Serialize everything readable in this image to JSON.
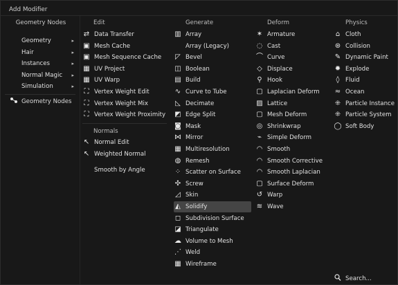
{
  "menu": {
    "title": "Add Modifier"
  },
  "left": {
    "header": "Geometry Nodes",
    "items": [
      {
        "label": "Geometry",
        "arrow": "▸"
      },
      {
        "label": "Hair",
        "arrow": "▸"
      },
      {
        "label": "Instances",
        "arrow": "▸"
      },
      {
        "label": "Normal Magic",
        "arrow": "▸"
      },
      {
        "label": "Simulation",
        "arrow": "▸"
      }
    ],
    "geometry_nodes": {
      "label": "Geometry Nodes",
      "icon": "geometry-nodes-icon"
    }
  },
  "edit": {
    "header": "Edit",
    "items": [
      {
        "label": "Data Transfer",
        "icon": "data-transfer-icon"
      },
      {
        "label": "Mesh Cache",
        "icon": "mesh-cache-icon"
      },
      {
        "label": "Mesh Sequence Cache",
        "icon": "mesh-sequence-cache-icon"
      },
      {
        "label": "UV Project",
        "icon": "uv-project-icon"
      },
      {
        "label": "UV Warp",
        "icon": "uv-warp-icon"
      },
      {
        "label": "Vertex Weight Edit",
        "icon": "vertex-weight-edit-icon"
      },
      {
        "label": "Vertex Weight Mix",
        "icon": "vertex-weight-mix-icon"
      },
      {
        "label": "Vertex Weight Proximity",
        "icon": "vertex-weight-proximity-icon"
      }
    ]
  },
  "normals": {
    "header": "Normals",
    "items": [
      {
        "label": "Normal Edit",
        "icon": "normal-edit-icon"
      },
      {
        "label": "Weighted Normal",
        "icon": "weighted-normal-icon"
      },
      {
        "label": "Smooth by Angle",
        "icon": ""
      }
    ]
  },
  "generate": {
    "header": "Generate",
    "items": [
      {
        "label": "Array",
        "icon": "array-icon"
      },
      {
        "label": "Array (Legacy)",
        "icon": ""
      },
      {
        "label": "Bevel",
        "icon": "bevel-icon"
      },
      {
        "label": "Boolean",
        "icon": "boolean-icon"
      },
      {
        "label": "Build",
        "icon": "build-icon"
      },
      {
        "label": "Curve to Tube",
        "icon": "curve-to-tube-icon"
      },
      {
        "label": "Decimate",
        "icon": "decimate-icon"
      },
      {
        "label": "Edge Split",
        "icon": "edge-split-icon"
      },
      {
        "label": "Mask",
        "icon": "mask-icon"
      },
      {
        "label": "Mirror",
        "icon": "mirror-icon"
      },
      {
        "label": "Multiresolution",
        "icon": "multiresolution-icon"
      },
      {
        "label": "Remesh",
        "icon": "remesh-icon"
      },
      {
        "label": "Scatter on Surface",
        "icon": "scatter-on-surface-icon"
      },
      {
        "label": "Screw",
        "icon": "screw-icon"
      },
      {
        "label": "Skin",
        "icon": "skin-icon"
      },
      {
        "label": "Solidify",
        "icon": "solidify-icon",
        "highlighted": true
      },
      {
        "label": "Subdivision Surface",
        "icon": "subdivision-surface-icon"
      },
      {
        "label": "Triangulate",
        "icon": "triangulate-icon"
      },
      {
        "label": "Volume to Mesh",
        "icon": "volume-to-mesh-icon"
      },
      {
        "label": "Weld",
        "icon": "weld-icon"
      },
      {
        "label": "Wireframe",
        "icon": "wireframe-icon"
      }
    ]
  },
  "deform": {
    "header": "Deform",
    "items": [
      {
        "label": "Armature",
        "icon": "armature-icon"
      },
      {
        "label": "Cast",
        "icon": "cast-icon"
      },
      {
        "label": "Curve",
        "icon": "curve-icon"
      },
      {
        "label": "Displace",
        "icon": "displace-icon"
      },
      {
        "label": "Hook",
        "icon": "hook-icon"
      },
      {
        "label": "Laplacian Deform",
        "icon": "laplacian-deform-icon"
      },
      {
        "label": "Lattice",
        "icon": "lattice-icon"
      },
      {
        "label": "Mesh Deform",
        "icon": "mesh-deform-icon"
      },
      {
        "label": "Shrinkwrap",
        "icon": "shrinkwrap-icon"
      },
      {
        "label": "Simple Deform",
        "icon": "simple-deform-icon"
      },
      {
        "label": "Smooth",
        "icon": "smooth-icon"
      },
      {
        "label": "Smooth Corrective",
        "icon": "smooth-corrective-icon"
      },
      {
        "label": "Smooth Laplacian",
        "icon": "smooth-laplacian-icon"
      },
      {
        "label": "Surface Deform",
        "icon": "surface-deform-icon"
      },
      {
        "label": "Warp",
        "icon": "warp-icon"
      },
      {
        "label": "Wave",
        "icon": "wave-icon"
      }
    ]
  },
  "physics": {
    "header": "Physics",
    "items": [
      {
        "label": "Cloth",
        "icon": "cloth-icon"
      },
      {
        "label": "Collision",
        "icon": "collision-icon"
      },
      {
        "label": "Dynamic Paint",
        "icon": "dynamic-paint-icon"
      },
      {
        "label": "Explode",
        "icon": "explode-icon"
      },
      {
        "label": "Fluid",
        "icon": "fluid-icon"
      },
      {
        "label": "Ocean",
        "icon": "ocean-icon"
      },
      {
        "label": "Particle Instance",
        "icon": "particle-instance-icon"
      },
      {
        "label": "Particle System",
        "icon": "particle-system-icon"
      },
      {
        "label": "Soft Body",
        "icon": "soft-body-icon"
      }
    ]
  },
  "search": {
    "label": "Search...",
    "icon": "search-icon"
  },
  "colors": {
    "background": "#181818",
    "highlight": "#454545",
    "text": "#e2e2e2",
    "header": "#bdbdbd"
  }
}
